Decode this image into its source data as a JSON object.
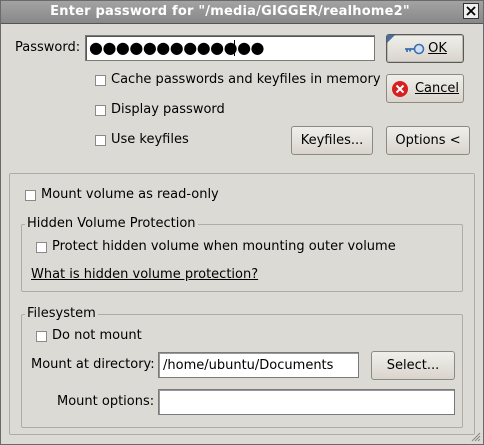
{
  "window": {
    "title": "Enter password for \"/media/GIGGER/realhome2\""
  },
  "password": {
    "label": "Password:",
    "value": "●●●●●●●●●●●●●"
  },
  "options": {
    "cache": "Cache passwords and keyfiles in memory",
    "display": "Display password",
    "keyfiles_check": "Use keyfiles"
  },
  "buttons": {
    "ok": "OK",
    "cancel": "Cancel",
    "keyfiles": "Keyfiles...",
    "options": "Options <",
    "select": "Select..."
  },
  "mount": {
    "readonly": "Mount volume as read-only",
    "hidden_group": "Hidden Volume Protection",
    "protect_hidden": "Protect hidden volume when mounting outer volume",
    "hidden_link": "What is hidden volume protection?",
    "fs_group": "Filesystem",
    "do_not_mount": "Do not mount",
    "dir_label": "Mount at directory:",
    "dir_value": "/home/ubuntu/Documents",
    "options_label": "Mount options:",
    "options_value": ""
  },
  "icons": {
    "ok": "key-icon",
    "cancel": "cancel-icon",
    "close": "close-icon"
  },
  "colors": {
    "cancel_icon": "#d62020",
    "ok_icon": "#3a6fb0",
    "titlebar": "#959595"
  }
}
